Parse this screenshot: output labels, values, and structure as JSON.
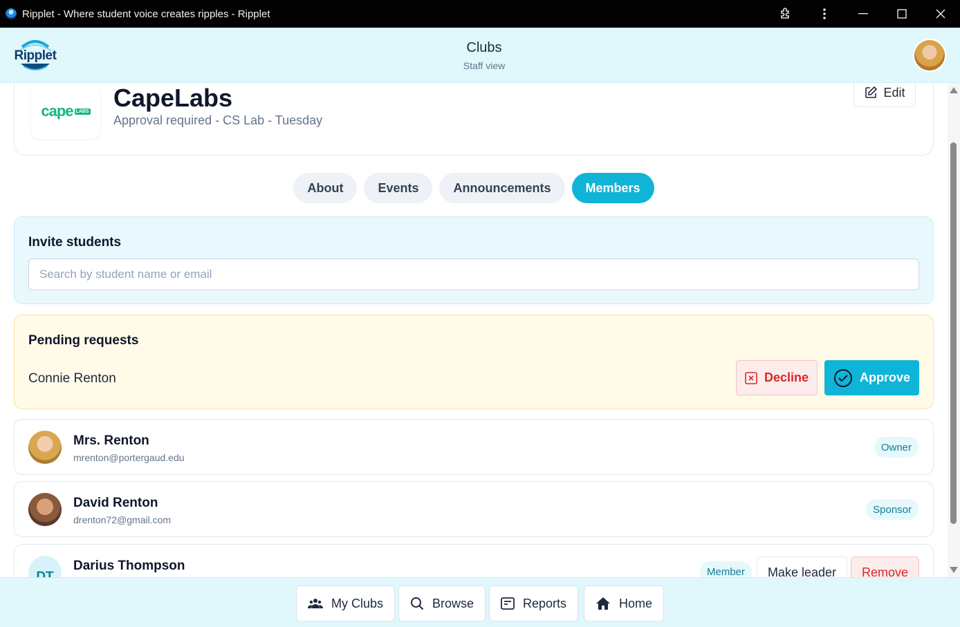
{
  "window": {
    "title": "Ripplet - Where student voice creates ripples - Ripplet"
  },
  "header": {
    "logo_text": "Ripplet",
    "title": "Clubs",
    "subtitle": "Staff view"
  },
  "club": {
    "logo_text": "cape",
    "logo_badge": "LABS",
    "name": "CapeLabs",
    "meta": "Approval required - CS Lab - Tuesday",
    "edit_label": "Edit"
  },
  "tabs": [
    {
      "label": "About",
      "active": false
    },
    {
      "label": "Events",
      "active": false
    },
    {
      "label": "Announcements",
      "active": false
    },
    {
      "label": "Members",
      "active": true
    }
  ],
  "invite": {
    "title": "Invite students",
    "placeholder": "Search by student name or email",
    "value": ""
  },
  "pending": {
    "title": "Pending requests",
    "requests": [
      {
        "name": "Connie Renton",
        "decline_label": "Decline",
        "approve_label": "Approve"
      }
    ]
  },
  "members": [
    {
      "name": "Mrs. Renton",
      "email": "mrenton@portergaud.edu",
      "role": "Owner"
    },
    {
      "name": "David Renton",
      "email": "drenton72@gmail.com",
      "role": "Sponsor"
    },
    {
      "name": "Darius Thompson",
      "initials": "DT",
      "email": "",
      "role": "Member",
      "make_leader_label": "Make leader",
      "remove_label": "Remove"
    }
  ],
  "bottom_nav": [
    {
      "label": "My Clubs",
      "icon": "users-icon"
    },
    {
      "label": "Browse",
      "icon": "search-icon"
    },
    {
      "label": "Reports",
      "icon": "report-icon"
    },
    {
      "label": "Home",
      "icon": "home-icon"
    }
  ],
  "colors": {
    "accent": "#10b4d6",
    "header_bg": "#e0f7fc",
    "danger": "#dc2626",
    "pending_bg": "#fffbe8"
  }
}
